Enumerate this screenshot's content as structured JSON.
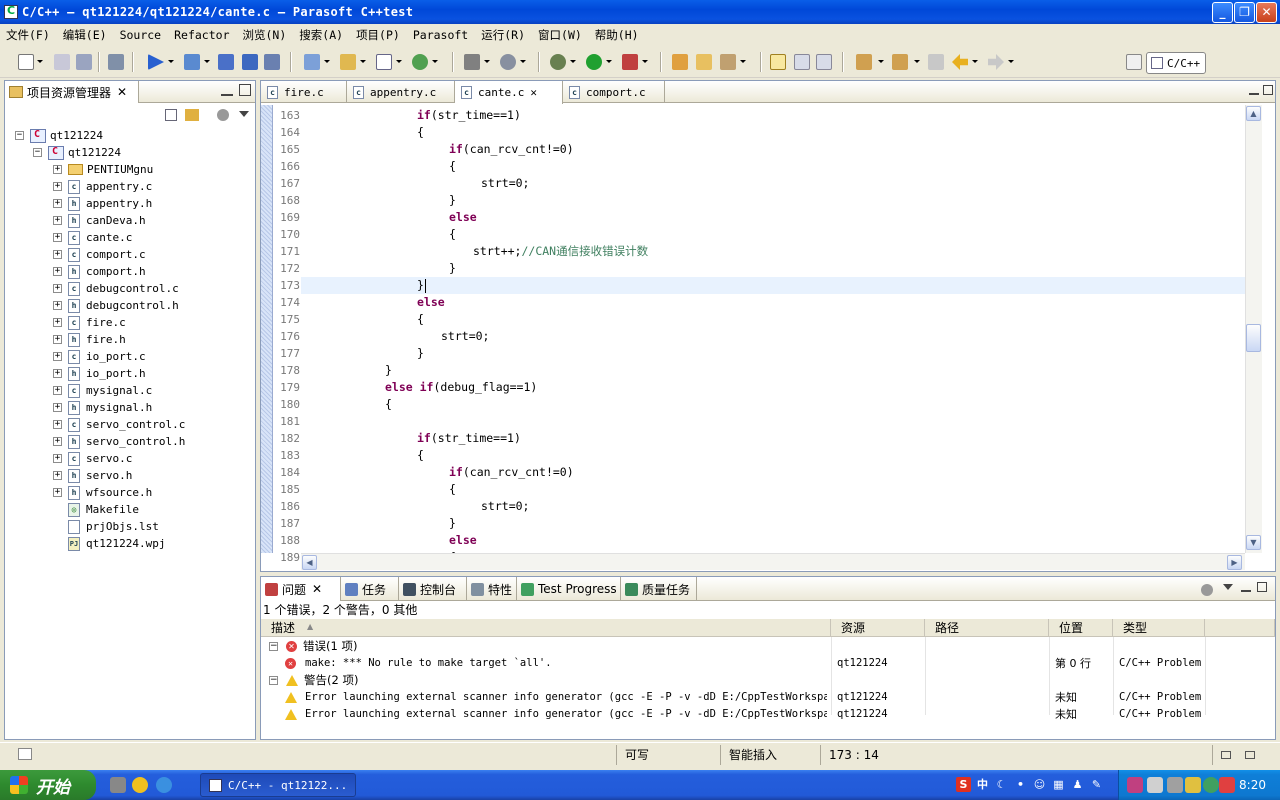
{
  "window": {
    "title": "C/C++ — qt121224/qt121224/cante.c — Parasoft C++test"
  },
  "menu": [
    "文件(F)",
    "编辑(E)",
    "Source",
    "Refactor",
    "浏览(N)",
    "搜索(A)",
    "项目(P)",
    "Parasoft",
    "运行(R)",
    "窗口(W)",
    "帮助(H)"
  ],
  "perspective": {
    "label": "C/C++"
  },
  "left_panel": {
    "tab_label": "项目资源管理器",
    "tree": [
      {
        "label": "qt121224",
        "type": "project",
        "level": 0
      },
      {
        "label": "qt121224",
        "type": "project",
        "level": 1
      },
      {
        "label": "PENTIUMgnu",
        "type": "folder",
        "level": 2
      },
      {
        "label": "appentry.c",
        "type": "c",
        "level": 2
      },
      {
        "label": "appentry.h",
        "type": "h",
        "level": 2
      },
      {
        "label": "canDeva.h",
        "type": "h",
        "level": 2
      },
      {
        "label": "cante.c",
        "type": "c",
        "level": 2
      },
      {
        "label": "comport.c",
        "type": "c",
        "level": 2
      },
      {
        "label": "comport.h",
        "type": "h",
        "level": 2
      },
      {
        "label": "debugcontrol.c",
        "type": "c",
        "level": 2
      },
      {
        "label": "debugcontrol.h",
        "type": "h",
        "level": 2
      },
      {
        "label": "fire.c",
        "type": "c",
        "level": 2
      },
      {
        "label": "fire.h",
        "type": "h",
        "level": 2
      },
      {
        "label": "io_port.c",
        "type": "c",
        "level": 2
      },
      {
        "label": "io_port.h",
        "type": "h",
        "level": 2
      },
      {
        "label": "mysignal.c",
        "type": "c",
        "level": 2
      },
      {
        "label": "mysignal.h",
        "type": "h",
        "level": 2
      },
      {
        "label": "servo_control.c",
        "type": "c",
        "level": 2
      },
      {
        "label": "servo_control.h",
        "type": "h",
        "level": 2
      },
      {
        "label": "servo.c",
        "type": "c",
        "level": 2
      },
      {
        "label": "servo.h",
        "type": "h",
        "level": 2
      },
      {
        "label": "wfsource.h",
        "type": "h",
        "level": 2
      },
      {
        "label": "Makefile",
        "type": "make",
        "level": 2
      },
      {
        "label": "prjObjs.lst",
        "type": "file",
        "level": 2
      },
      {
        "label": "qt121224.wpj",
        "type": "wpj",
        "level": 2
      }
    ]
  },
  "editor": {
    "tabs": [
      {
        "label": "fire.c",
        "active": false
      },
      {
        "label": "appentry.c",
        "active": false
      },
      {
        "label": "cante.c",
        "active": true
      },
      {
        "label": "comport.c",
        "active": false
      }
    ],
    "current_line": 173,
    "lines": [
      {
        "n": "163",
        "indent": 12,
        "tokens": [
          [
            "kw",
            "if"
          ],
          [
            "",
            "(str_time==1)"
          ]
        ]
      },
      {
        "n": "164",
        "indent": 12,
        "tokens": [
          [
            "",
            "{"
          ]
        ]
      },
      {
        "n": "165",
        "indent": 16,
        "tokens": [
          [
            "kw",
            "if"
          ],
          [
            "",
            "(can_rcv_cnt!=0)"
          ]
        ]
      },
      {
        "n": "166",
        "indent": 16,
        "tokens": [
          [
            "",
            "{"
          ]
        ]
      },
      {
        "n": "167",
        "indent": 20,
        "tokens": [
          [
            "",
            "strt=0;"
          ]
        ]
      },
      {
        "n": "168",
        "indent": 16,
        "tokens": [
          [
            "",
            "}"
          ]
        ]
      },
      {
        "n": "169",
        "indent": 16,
        "tokens": [
          [
            "kw",
            "else"
          ]
        ]
      },
      {
        "n": "170",
        "indent": 16,
        "tokens": [
          [
            "",
            "{"
          ]
        ]
      },
      {
        "n": "171",
        "indent": 19,
        "tokens": [
          [
            "",
            "strt++;"
          ],
          [
            "cm",
            "//CAN通信接收错误计数"
          ]
        ]
      },
      {
        "n": "172",
        "indent": 16,
        "tokens": [
          [
            "",
            "}"
          ]
        ]
      },
      {
        "n": "173",
        "indent": 12,
        "tokens": [
          [
            "",
            "}"
          ]
        ]
      },
      {
        "n": "174",
        "indent": 12,
        "tokens": [
          [
            "kw",
            "else"
          ]
        ]
      },
      {
        "n": "175",
        "indent": 12,
        "tokens": [
          [
            "",
            "{"
          ]
        ]
      },
      {
        "n": "176",
        "indent": 15,
        "tokens": [
          [
            "",
            "strt=0;"
          ]
        ]
      },
      {
        "n": "177",
        "indent": 12,
        "tokens": [
          [
            "",
            "}"
          ]
        ]
      },
      {
        "n": "178",
        "indent": 8,
        "tokens": [
          [
            "",
            "}"
          ]
        ]
      },
      {
        "n": "179",
        "indent": 8,
        "tokens": [
          [
            "kw",
            "else if"
          ],
          [
            "",
            "(debug_flag==1)"
          ]
        ]
      },
      {
        "n": "180",
        "indent": 8,
        "tokens": [
          [
            "",
            "{"
          ]
        ]
      },
      {
        "n": "181",
        "indent": 0,
        "tokens": []
      },
      {
        "n": "182",
        "indent": 12,
        "tokens": [
          [
            "kw",
            "if"
          ],
          [
            "",
            "(str_time==1)"
          ]
        ]
      },
      {
        "n": "183",
        "indent": 12,
        "tokens": [
          [
            "",
            "{"
          ]
        ]
      },
      {
        "n": "184",
        "indent": 16,
        "tokens": [
          [
            "kw",
            "if"
          ],
          [
            "",
            "(can_rcv_cnt!=0)"
          ]
        ]
      },
      {
        "n": "185",
        "indent": 16,
        "tokens": [
          [
            "",
            "{"
          ]
        ]
      },
      {
        "n": "186",
        "indent": 20,
        "tokens": [
          [
            "",
            "strt=0;"
          ]
        ]
      },
      {
        "n": "187",
        "indent": 16,
        "tokens": [
          [
            "",
            "}"
          ]
        ]
      },
      {
        "n": "188",
        "indent": 16,
        "tokens": [
          [
            "kw",
            "else"
          ]
        ]
      },
      {
        "n": "189",
        "indent": 16,
        "tokens": [
          [
            "",
            "{"
          ]
        ]
      }
    ]
  },
  "bottom": {
    "tabs": [
      "问题",
      "任务",
      "控制台",
      "特性",
      "Test Progress",
      "质量任务"
    ],
    "summary": "1 个错误，2 个警告，0 其他",
    "columns": [
      "描述",
      "资源",
      "路径",
      "位置",
      "类型"
    ],
    "groups": [
      {
        "label": "错误(1 项)",
        "kind": "error",
        "items": [
          {
            "desc": "make: *** No rule to make target `all'.",
            "resource": "qt121224",
            "path": "",
            "location": "第 0 行",
            "type": "C/C++ Problem"
          }
        ]
      },
      {
        "label": "警告(2 项)",
        "kind": "warning",
        "items": [
          {
            "desc": "Error launching external scanner info generator (gcc -E -P -v -dD E:/CppTestWorkspace",
            "resource": "qt121224",
            "path": "",
            "location": "未知",
            "type": "C/C++ Problem"
          },
          {
            "desc": "Error launching external scanner info generator (gcc -E -P -v -dD E:/CppTestWorkspace",
            "resource": "qt121224",
            "path": "",
            "location": "未知",
            "type": "C/C++ Problem"
          }
        ]
      }
    ]
  },
  "status": {
    "writable": "可写",
    "insert_mode": "智能插入",
    "position": "173 : 14"
  },
  "taskbar": {
    "start_label": "开始",
    "task_item": "C/C++ - qt12122...",
    "clock": "8:20",
    "ime": "中"
  },
  "colors": {
    "keyword": "#7f0055",
    "comment": "#3f7f5f",
    "current_line": "#e8f2fe",
    "titlebar": "#0a52e0"
  }
}
